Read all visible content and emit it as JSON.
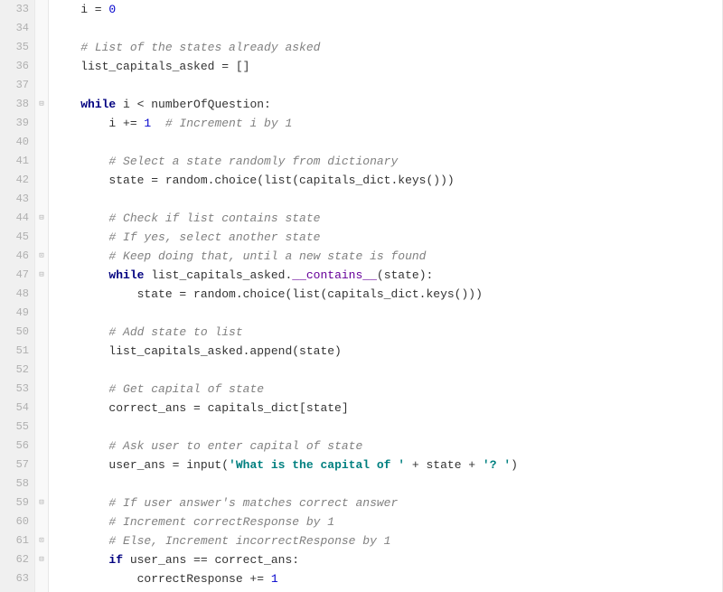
{
  "lines": [
    {
      "num": 33,
      "fold": "",
      "html": "    i = <span class='num'>0</span>"
    },
    {
      "num": 34,
      "fold": "",
      "html": ""
    },
    {
      "num": 35,
      "fold": "",
      "html": "    <span class='cmt'># List of the states already asked</span>"
    },
    {
      "num": 36,
      "fold": "",
      "html": "    list_capitals_asked = []"
    },
    {
      "num": 37,
      "fold": "",
      "html": ""
    },
    {
      "num": 38,
      "fold": "⊟",
      "html": "    <span class='kw'>while</span> i &lt; numberOfQuestion:"
    },
    {
      "num": 39,
      "fold": "",
      "html": "        i += <span class='num'>1</span>  <span class='cmt'># Increment i by 1</span>"
    },
    {
      "num": 40,
      "fold": "",
      "html": ""
    },
    {
      "num": 41,
      "fold": "",
      "html": "        <span class='cmt'># Select a state randomly from dictionary</span>"
    },
    {
      "num": 42,
      "fold": "",
      "html": "        state = random.choice(list(capitals_dict.keys()))"
    },
    {
      "num": 43,
      "fold": "",
      "html": ""
    },
    {
      "num": 44,
      "fold": "⊟",
      "html": "        <span class='cmt'># Check if list contains state</span>"
    },
    {
      "num": 45,
      "fold": "",
      "html": "        <span class='cmt'># If yes, select another state</span>"
    },
    {
      "num": 46,
      "fold": "⊡",
      "html": "        <span class='cmt'># Keep doing that, until a new state is found</span>"
    },
    {
      "num": 47,
      "fold": "⊟",
      "html": "        <span class='kw'>while</span> list_capitals_asked.<span class='mag'>__contains__</span>(state):"
    },
    {
      "num": 48,
      "fold": "",
      "html": "            state = random.choice(list(capitals_dict.keys()))"
    },
    {
      "num": 49,
      "fold": "",
      "html": ""
    },
    {
      "num": 50,
      "fold": "",
      "html": "        <span class='cmt'># Add state to list</span>"
    },
    {
      "num": 51,
      "fold": "",
      "html": "        list_capitals_asked.append(state)"
    },
    {
      "num": 52,
      "fold": "",
      "html": ""
    },
    {
      "num": 53,
      "fold": "",
      "html": "        <span class='cmt'># Get capital of state</span>"
    },
    {
      "num": 54,
      "fold": "",
      "html": "        correct_ans = capitals_dict[state]"
    },
    {
      "num": 55,
      "fold": "",
      "html": ""
    },
    {
      "num": 56,
      "fold": "",
      "html": "        <span class='cmt'># Ask user to enter capital of state</span>"
    },
    {
      "num": 57,
      "fold": "",
      "html": "        user_ans = input(<span class='str'>'What is the capital of '</span> + state + <span class='str'>'? '</span>)"
    },
    {
      "num": 58,
      "fold": "",
      "html": ""
    },
    {
      "num": 59,
      "fold": "⊟",
      "html": "        <span class='cmt'># If user answer's matches correct answer</span>"
    },
    {
      "num": 60,
      "fold": "",
      "html": "        <span class='cmt'># Increment correctResponse by 1</span>"
    },
    {
      "num": 61,
      "fold": "⊡",
      "html": "        <span class='cmt'># Else, Increment incorrectResponse by 1</span>"
    },
    {
      "num": 62,
      "fold": "⊟",
      "html": "        <span class='kw'>if</span> user_ans == correct_ans:"
    },
    {
      "num": 63,
      "fold": "",
      "html": "            correctResponse += <span class='num'>1</span>"
    }
  ]
}
